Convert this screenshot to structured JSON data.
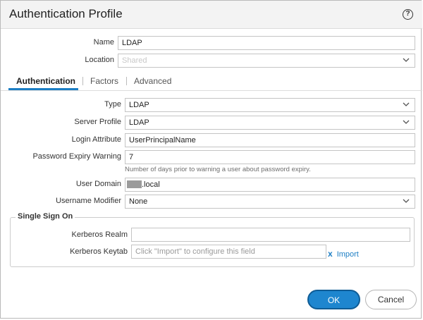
{
  "dialog": {
    "title": "Authentication Profile",
    "help_icon": "help-circle-icon",
    "help_glyph": "?"
  },
  "general": {
    "name_label": "Name",
    "name_value": "LDAP",
    "location_label": "Location",
    "location_value": "Shared"
  },
  "tabs": [
    {
      "label": "Authentication",
      "active": true
    },
    {
      "label": "Factors",
      "active": false
    },
    {
      "label": "Advanced",
      "active": false
    }
  ],
  "auth": {
    "type_label": "Type",
    "type_value": "LDAP",
    "server_profile_label": "Server Profile",
    "server_profile_value": "LDAP",
    "login_attribute_label": "Login Attribute",
    "login_attribute_value": "UserPrincipalName",
    "password_expiry_label": "Password Expiry Warning",
    "password_expiry_value": "7",
    "password_expiry_hint": "Number of days prior to warning a user about password expiry.",
    "user_domain_label": "User Domain",
    "user_domain_value": ".local",
    "username_modifier_label": "Username Modifier",
    "username_modifier_value": "None"
  },
  "sso": {
    "legend": "Single Sign On",
    "kerberos_realm_label": "Kerberos Realm",
    "kerberos_realm_value": "",
    "kerberos_keytab_label": "Kerberos Keytab",
    "kerberos_keytab_placeholder": "Click \"Import\" to configure this field",
    "import_icon": "x",
    "import_label": "Import"
  },
  "buttons": {
    "ok": "OK",
    "cancel": "Cancel"
  },
  "colors": {
    "accent": "#1e86cf",
    "link": "#1c7ec4"
  }
}
